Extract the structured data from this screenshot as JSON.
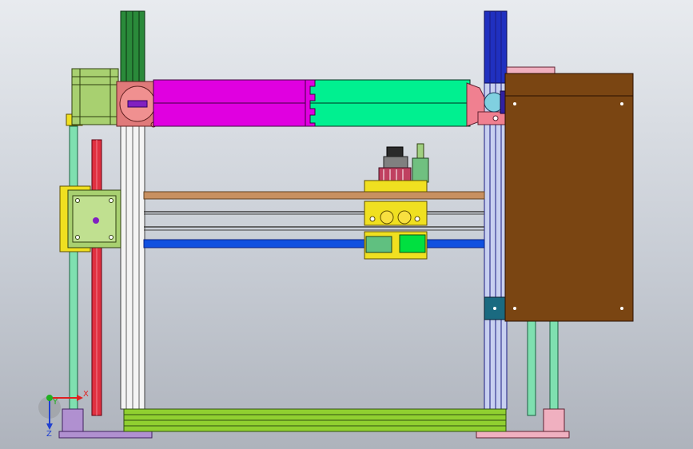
{
  "window": {
    "type": "cad-3d-viewport"
  },
  "triad": {
    "x_label": "X",
    "y_label": "Y",
    "z_label": "Z",
    "x_color": "#e02020",
    "y_color": "#20b020",
    "z_color": "#2040d0"
  },
  "colors": {
    "background_top": "#e8ebef",
    "background_bottom": "#aeb3bc",
    "cylinder_left": "#e000e0",
    "cylinder_right": "#00f090",
    "motor_body": "#a8d070",
    "brown_panel": "#7a4512",
    "rail_yellow": "#f0e020",
    "base_green": "#90d030",
    "blue_rod": "#1050e0",
    "tan_rod": "#c89060",
    "red_rod": "#e03040",
    "left_post_green": "#2a8a3a",
    "right_post_blue": "#2030c0"
  },
  "icons": {
    "triad": "coordinate-triad-icon"
  }
}
